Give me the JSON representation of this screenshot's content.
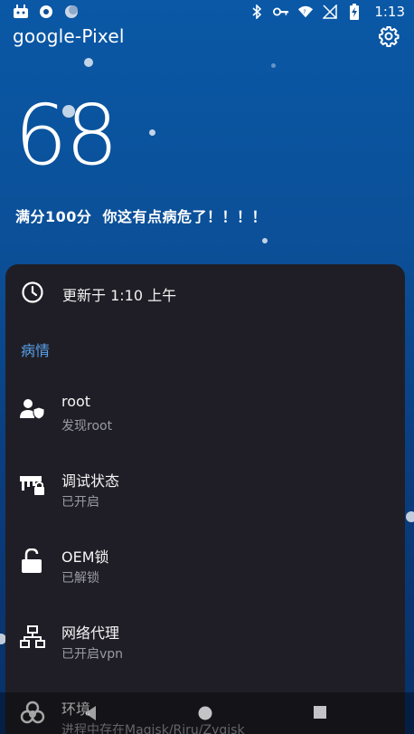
{
  "status_bar": {
    "time": "1:13",
    "battery_label": "charging",
    "left_icons": [
      "robot-icon",
      "circle-notification-icon",
      "moon-icon"
    ],
    "right_icons": [
      "bluetooth-icon",
      "vpn-key-icon",
      "wifi-icon",
      "no-signal-icon",
      "battery-charging-icon"
    ]
  },
  "header": {
    "title": "google-Pixel",
    "settings_icon": "gear-icon"
  },
  "score": {
    "value": "68",
    "caption": "满分100分  你这有点病危了！！！！"
  },
  "sheet": {
    "update_text": "更新于 1:10 上午",
    "update_icon": "clock-icon",
    "section_title": "病情",
    "items": [
      {
        "title": "root",
        "subtitle": "发现root",
        "icon": "user-shield-icon"
      },
      {
        "title": "调试状态",
        "subtitle": "已开启",
        "icon": "debug-lock-icon"
      },
      {
        "title": "OEM锁",
        "subtitle": "已解锁",
        "icon": "unlock-icon"
      },
      {
        "title": "网络代理",
        "subtitle": "已开启vpn",
        "icon": "network-icon"
      },
      {
        "title": "环境",
        "subtitle": "进程中存在Magisk/Riru/Zygisk",
        "icon": "biohazard-icon"
      }
    ]
  },
  "nav": {
    "back": "back-icon",
    "home": "home-icon",
    "recents": "recents-icon"
  },
  "colors": {
    "background": "#0b4f97",
    "sheet": "#1f1e26",
    "accent": "#5aa0e8"
  }
}
